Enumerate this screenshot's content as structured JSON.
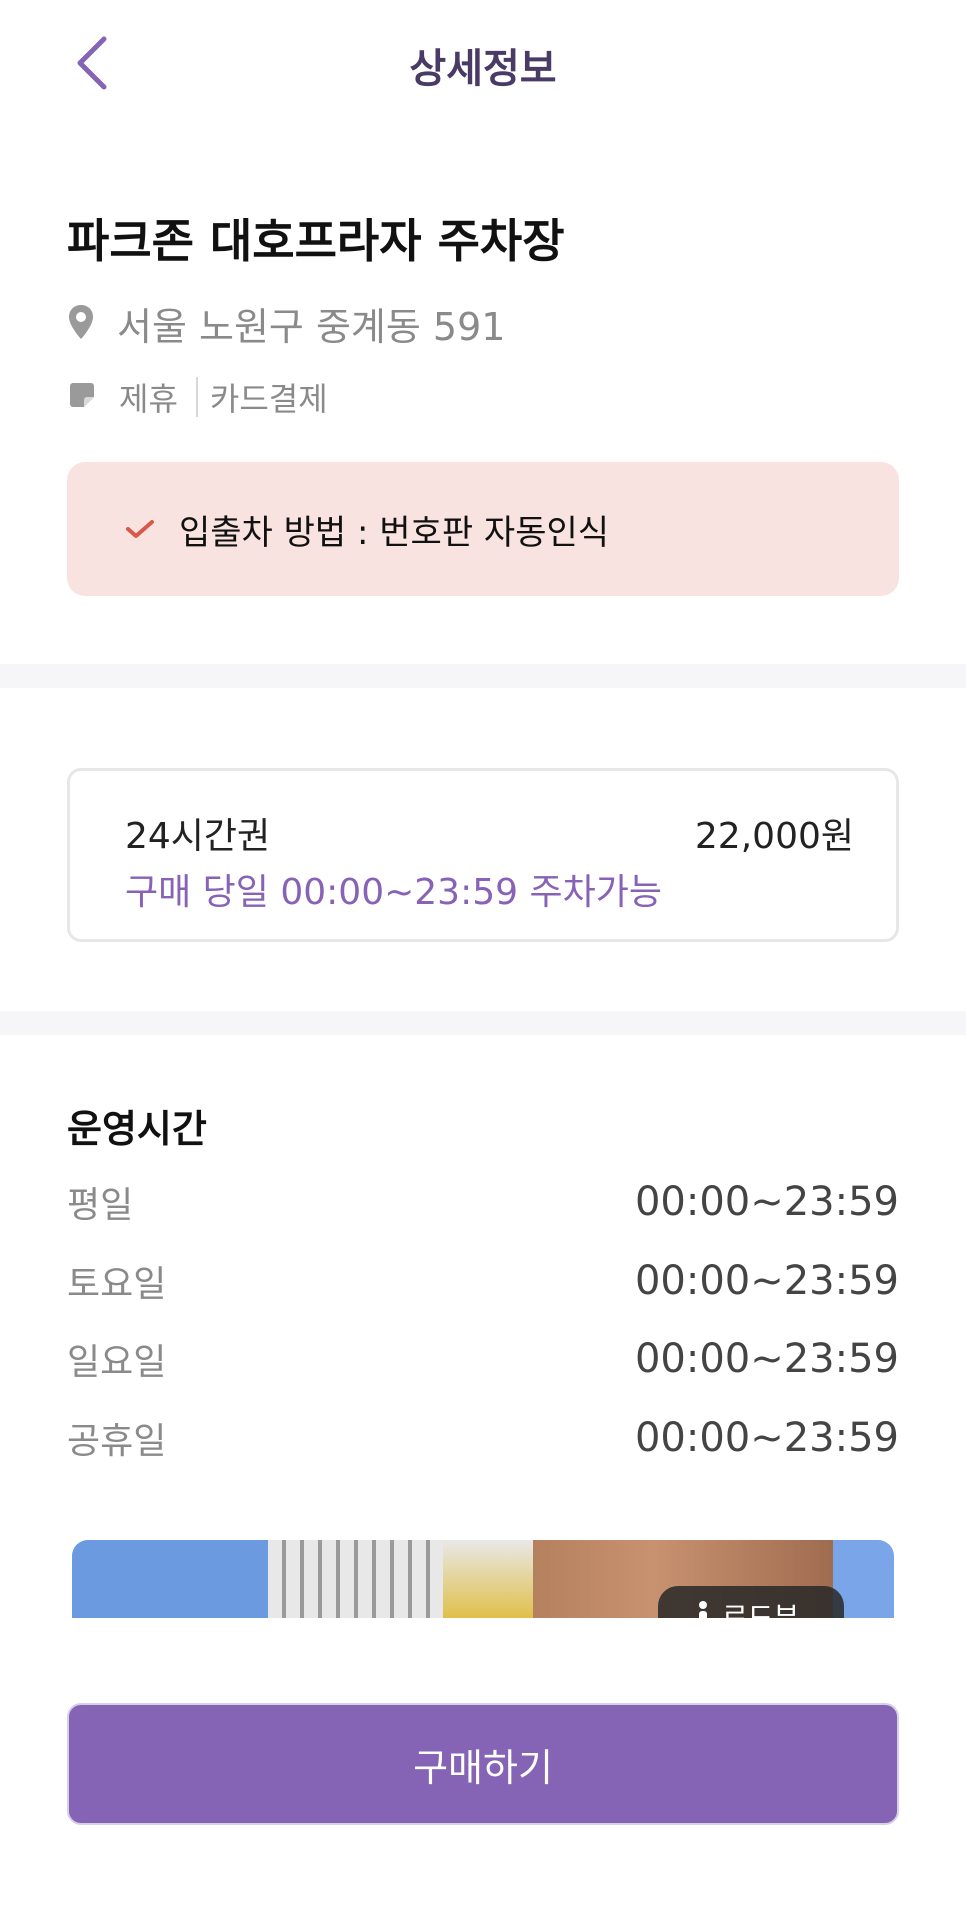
{
  "header": {
    "title": "상세정보",
    "back_icon": "chevron-left-icon"
  },
  "lot": {
    "name": "파크존 대호프라자 주차장",
    "address": "서울 노원구 중계동 591",
    "tags": [
      "제휴",
      "카드결제"
    ]
  },
  "notice": {
    "text": "입출차 방법 : 번호판 자동인식"
  },
  "ticket": {
    "name": "24시간권",
    "price": "22,000원",
    "desc": "구매 당일 00:00~23:59 주차가능"
  },
  "hours": {
    "title": "운영시간",
    "rows": [
      {
        "day": "평일",
        "time": "00:00~23:59"
      },
      {
        "day": "토요일",
        "time": "00:00~23:59"
      },
      {
        "day": "일요일",
        "time": "00:00~23:59"
      },
      {
        "day": "공휴일",
        "time": "00:00~23:59"
      }
    ]
  },
  "photo": {
    "roadview_label": "로드뷰"
  },
  "buy": {
    "label": "구매하기"
  },
  "colors": {
    "accent": "#8563b5",
    "title_dark": "#4a3b66",
    "notice_bg": "#f9e3e0",
    "check": "#d6594a"
  }
}
